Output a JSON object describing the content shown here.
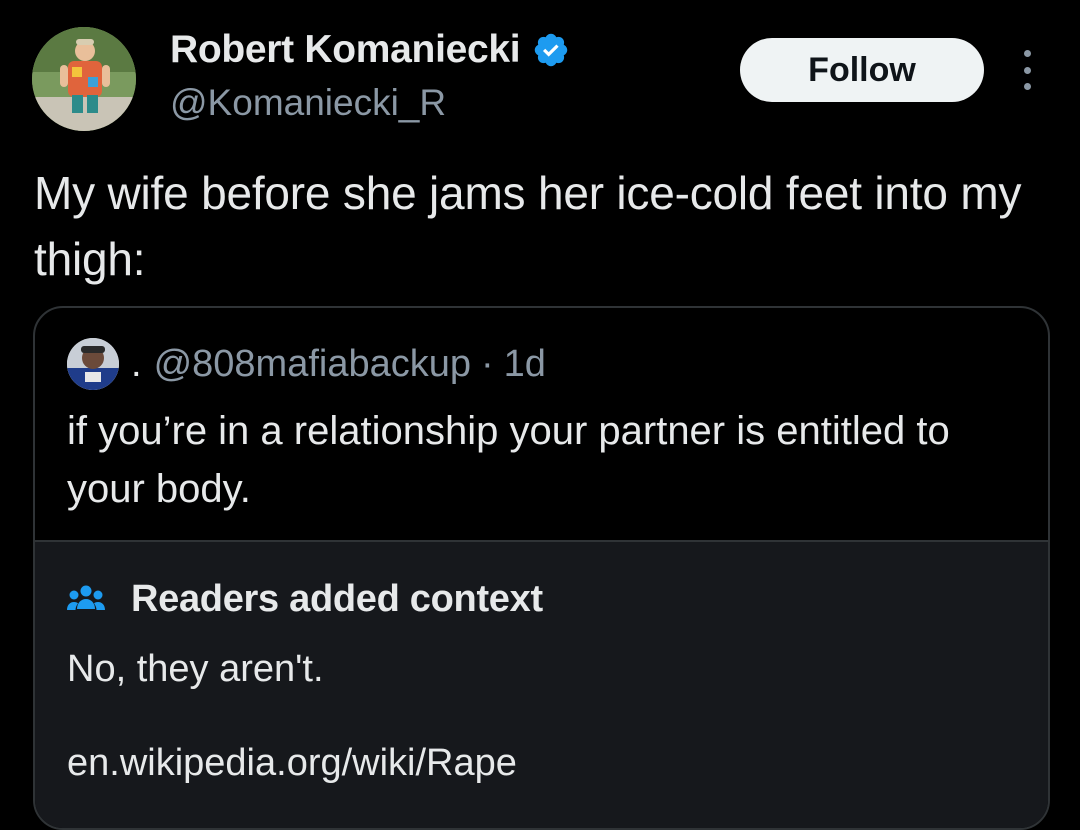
{
  "author": {
    "display_name": "Robert Komaniecki",
    "handle": "@Komaniecki_R",
    "verified": true,
    "verified_color": "#1d9bf0"
  },
  "follow_button": {
    "label": "Follow"
  },
  "more_menu": {
    "icon": "more-vertical-icon"
  },
  "tweet": {
    "text": "My wife before she jams her ice-cold feet into my thigh:"
  },
  "quoted_tweet": {
    "name": ".",
    "handle": "@808mafiabackup",
    "separator": "·",
    "time": "1d",
    "text": "if you’re in a relationship your partner is entitled to your body."
  },
  "community_note": {
    "icon": "people-icon",
    "title": "Readers added context",
    "body": "No, they aren't.",
    "link": "en.wikipedia.org/wiki/Rape",
    "icon_color": "#1d9bf0"
  },
  "colors": {
    "background": "#000000",
    "text": "#e7e9ea",
    "secondary_text": "#8b98a5",
    "border": "#2f3336",
    "note_background": "#16181c"
  }
}
